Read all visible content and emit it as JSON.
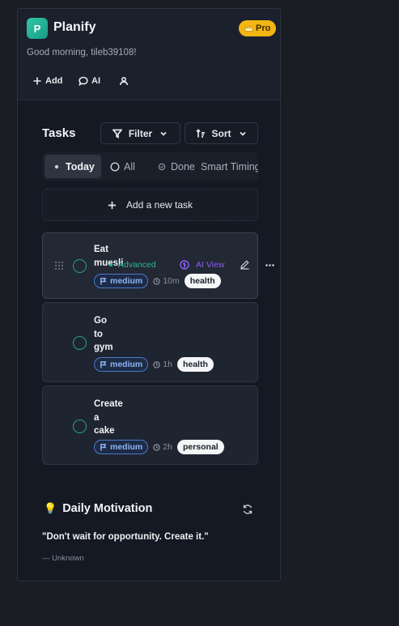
{
  "header": {
    "logo_letter": "P",
    "app_name": "Planify",
    "pro_badge": "Pro",
    "greeting": "Good morning, tileb39108!",
    "actions": [
      {
        "label": "Add",
        "icon": "plus-icon"
      },
      {
        "label": "AI",
        "icon": "chat-bubble-icon"
      },
      {
        "label": "",
        "icon": "user-icon"
      }
    ]
  },
  "tasks": {
    "title": "Tasks",
    "filter_label": "Filter",
    "sort_label": "Sort",
    "tabs": [
      {
        "label": "Today",
        "active": true
      },
      {
        "label": "All",
        "active": false
      },
      {
        "label": "Done",
        "active": false
      },
      {
        "label": "Smart Timing",
        "active": false
      }
    ],
    "add_task_label": "Add a new task",
    "items": [
      {
        "title_lines": [
          "Eat",
          "muesli"
        ],
        "priority": "medium",
        "duration": "10m",
        "tag": "health",
        "advanced_label": "Advanced",
        "ai_view_label": "AI View"
      },
      {
        "title_lines": [
          "Go",
          "to",
          "gym"
        ],
        "priority": "medium",
        "duration": "1h",
        "tag": "health"
      },
      {
        "title_lines": [
          "Create",
          "a",
          "cake"
        ],
        "priority": "medium",
        "duration": "2h",
        "tag": "personal"
      }
    ]
  },
  "motivation": {
    "emoji": "💡",
    "title": "Daily Motivation",
    "quote": "\"Don't wait for opportunity. Create it.\"",
    "author": "— Unknown"
  },
  "colors": {
    "page_bg": "#1a1d24",
    "panel_bg": "#141923",
    "accent_teal": "#2fc7a8",
    "pro_gold": "#f2b511",
    "priority_blue": "#8fb3f2",
    "ai_purple": "#8b5cf6"
  }
}
